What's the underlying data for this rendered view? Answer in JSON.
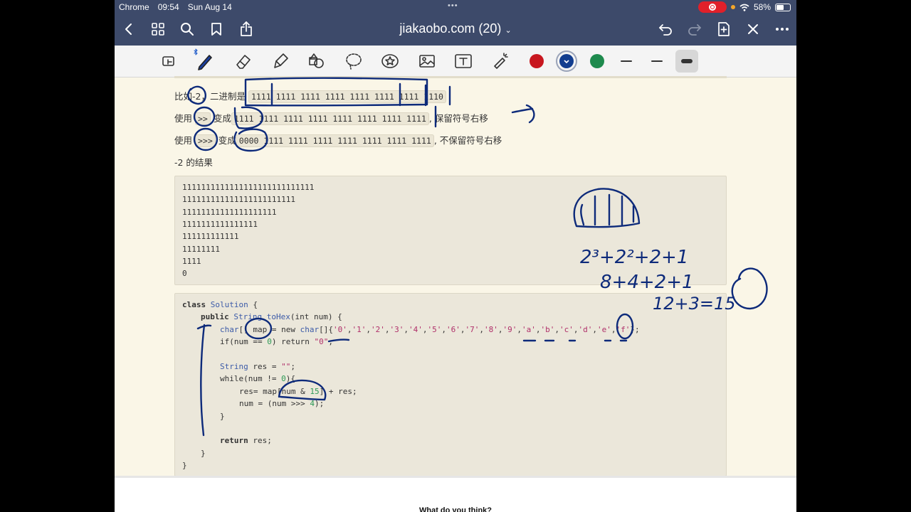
{
  "status_bar": {
    "app": "Chrome",
    "time": "09:54",
    "date": "Sun Aug 14",
    "dots": "•••",
    "battery": "58%"
  },
  "nav": {
    "title": "jiakaobo.com (20)"
  },
  "toolbar": {
    "colors": [
      "#c8171f",
      "#123d8f",
      "#1e8a4d"
    ],
    "selected_color": "#123d8f"
  },
  "content": {
    "line1": {
      "prefix": "比如-2，二进制是",
      "binary": "1111 1111 1111 1111 1111 1111 1111 1110"
    },
    "line2": {
      "prefix": "使用",
      "op": ">>",
      "mid": "变成",
      "binary": "1111 1111 1111 1111 1111 1111 1111 1111",
      "suffix": ", 保留符号右移"
    },
    "line3": {
      "prefix": "使用",
      "op": ">>>",
      "mid": "变成",
      "binary": "0000 1111 1111 1111 1111 1111 1111 1111",
      "suffix": ", 不保留符号右移"
    },
    "line4": "-2 的结果",
    "result_lines": [
      "1111111111111111111111111111",
      "111111111111111111111111",
      "11111111111111111111",
      "1111111111111111",
      "111111111111",
      "11111111",
      "1111",
      "0"
    ],
    "code": {
      "l1_kw": "class",
      "l1_name": "Solution",
      "l1_end": " {",
      "l2_kw": "public",
      "l2_type": "String",
      "l2_fn": "toHex",
      "l2_params": "(int num) {",
      "l3_type": "char",
      "l3_var": "[] map = new ",
      "l3_type2": "char",
      "l3_open": "[]{",
      "l3_chars": [
        "'0'",
        "'1'",
        "'2'",
        "'3'",
        "'4'",
        "'5'",
        "'6'",
        "'7'",
        "'8'",
        "'9'",
        "'a'",
        "'b'",
        "'c'",
        "'d'",
        "'e'",
        "'f'"
      ],
      "l3_close": "};",
      "l4_a": "if(num == ",
      "l4_num": "0",
      "l4_b": ") return ",
      "l4_str": "\"0\"",
      "l4_end": ";",
      "l6_type": "String",
      "l6_a": " res = ",
      "l6_str": "\"\"",
      "l6_end": ";",
      "l7_a": "while(num != ",
      "l7_num": "0",
      "l7_b": "){",
      "l8_a": "res= map[num & ",
      "l8_num": "15",
      "l8_b": "] + res;",
      "l9_a": "num = (num >>> ",
      "l9_num": "4",
      "l9_b": ");",
      "l10": "}",
      "l12_kw": "return",
      "l12_b": " res;",
      "l13": "}",
      "l14": "}"
    }
  },
  "handwriting": {
    "ones": "1111",
    "expr1": "2³+2²+2+1",
    "expr2": "8+4+2+1",
    "expr3": "12+3=15"
  },
  "footer": {
    "text": "What do you think?"
  }
}
